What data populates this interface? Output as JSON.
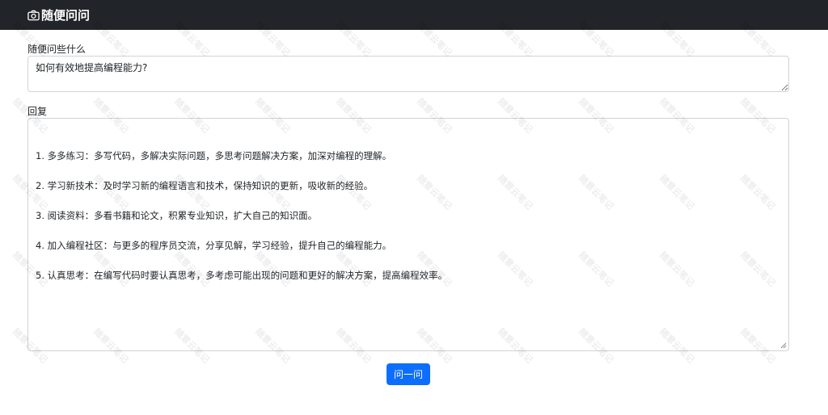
{
  "header": {
    "title": "随便问问",
    "icon": "camera-icon"
  },
  "question": {
    "label": "随便问些什么",
    "value": "如何有效地提高编程能力?"
  },
  "reply": {
    "label": "回复",
    "lines": [
      "1. 多多练习：多写代码，多解决实际问题，多思考问题解决方案，加深对编程的理解。",
      "2. 学习新技术：及时学习新的编程语言和技术，保持知识的更新，吸收新的经验。",
      "3. 阅读资料：多看书籍和论文，积累专业知识，扩大自己的知识面。",
      "4. 加入编程社区：与更多的程序员交流，分享见解，学习经验，提升自己的编程能力。",
      "5. 认真思考：在编写代码时要认真思考，多考虑可能出现的问题和更好的解决方案，提高编程效率。"
    ]
  },
  "submit": {
    "label": "问一问"
  },
  "watermark": {
    "text": "随意云笔记"
  },
  "colors": {
    "navbar": "#212529",
    "primary": "#0d6efd",
    "border": "#ced4da"
  }
}
